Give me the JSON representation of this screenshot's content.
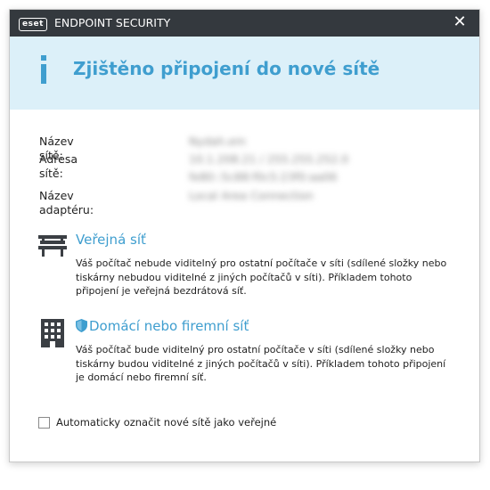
{
  "app": {
    "logo_text": "eset",
    "title": "ENDPOINT SECURITY",
    "close_label": "✕"
  },
  "dialog": {
    "title": "Zjištěno připojení do nové sítě",
    "accent_color": "#3f9ecf",
    "header_bg": "#dcf0f9"
  },
  "network_info": {
    "name_label": "Název sítě:",
    "name_value": "Nydah.em",
    "address_label": "Adresa sítě:",
    "address_value_1": "10.1.208.21 / 255.255.252.0",
    "address_value_2": "fe80::5c88:f0c5:23f0:aa06",
    "adapter_label": "Název adaptéru:",
    "adapter_value": "Local Area Connection"
  },
  "options": [
    {
      "icon": "bench-icon",
      "title": "Veřejná síť",
      "description": "Váš počítač nebude viditelný pro ostatní počítače v síti (sdílené složky nebo tiskárny nebudou viditelné z jiných počítačů v síti). Příkladem tohoto připojení je veřejná bezdrátová síť."
    },
    {
      "icon": "office-building-icon",
      "badge_icon": "shield-icon",
      "title": "Domácí nebo firemní síť",
      "description": "Váš počítač bude viditelný pro ostatní počítače v síti (sdílené složky nebo tiskárny budou viditelné z jiných počítačů v síti). Příkladem tohoto připojení je domácí nebo firemní síť."
    }
  ],
  "auto_public": {
    "label": "Automaticky označit nové sítě jako veřejné",
    "checked": false
  }
}
